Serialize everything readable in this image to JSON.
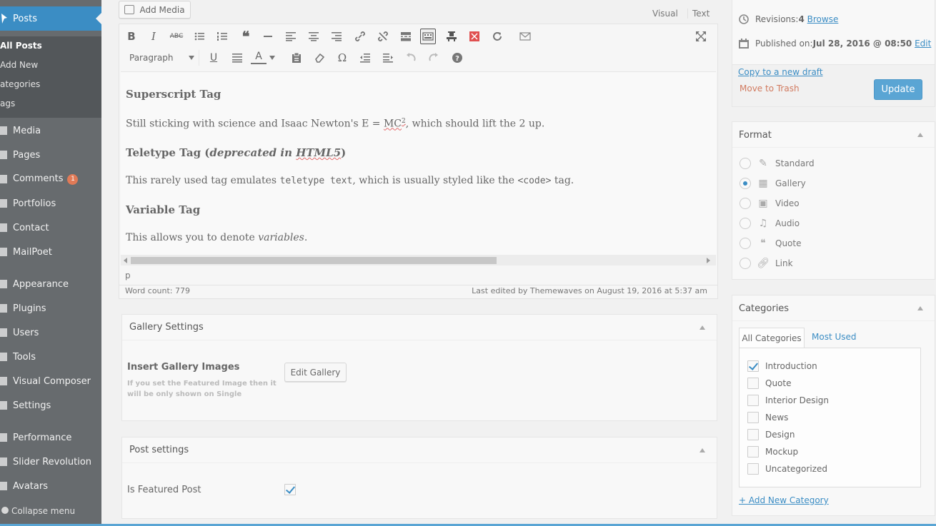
{
  "admin_menu": {
    "posts_label": "Posts",
    "submenu": [
      "All Posts",
      "Add New",
      "ategories",
      "ags"
    ],
    "items": [
      "Media",
      "Pages",
      "Comments",
      "Portfolios",
      "Contact",
      "MailPoet",
      "Appearance",
      "Plugins",
      "Users",
      "Tools",
      "Visual Composer",
      "Settings",
      "Performance",
      "Slider Revolution",
      "Avatars"
    ],
    "comments_badge": "1",
    "collapse_label": "Collapse menu"
  },
  "editor": {
    "add_media_label": "Add Media",
    "tab_visual": "Visual",
    "tab_text": "Text",
    "format_select": "Paragraph",
    "content": {
      "h_superscript": "Superscript Tag",
      "p_superscript_a": "Still sticking with science and Isaac Newton's E = ",
      "p_superscript_mc": "MC",
      "p_superscript_sup": "2",
      "p_superscript_b": ", which should lift the 2 up.",
      "h_teletype_a": "Teletype Tag (",
      "h_teletype_em": "deprecated in ",
      "h_teletype_html5": "HTML5",
      "h_teletype_b": ")",
      "p_teletype_a": "This rarely used tag emulates ",
      "p_teletype_code1": "teletype text",
      "p_teletype_b": ", which is usually styled like the ",
      "p_teletype_code2": "<code>",
      "p_teletype_c": " tag.",
      "h_variable": "Variable Tag",
      "p_variable_a": "This allows you to denote ",
      "p_variable_em": "variables",
      "p_variable_b": "."
    },
    "path": "p",
    "word_count": "Word count: 779",
    "last_edited": "Last edited by Themewaves on August 19, 2016 at 5:37 am"
  },
  "gallery_settings": {
    "title": "Gallery Settings",
    "insert_label": "Insert Gallery Images",
    "description": "If you set the Featured Image then it will be only shown on Single",
    "edit_button": "Edit Gallery"
  },
  "post_settings": {
    "title": "Post settings",
    "featured_label": "Is Featured Post",
    "featured_checked": true
  },
  "publish": {
    "revisions_label": "Revisions: ",
    "revisions_count": "4",
    "browse_link": "Browse",
    "published_label": "Published on: ",
    "published_date": "Jul 28, 2016 @ 08:50",
    "edit_link": "Edit",
    "copy_draft": "Copy to a new draft",
    "move_trash": "Move to Trash",
    "update_button": "Update"
  },
  "format_box": {
    "title": "Format",
    "options": [
      "Standard",
      "Gallery",
      "Video",
      "Audio",
      "Quote",
      "Link"
    ],
    "selected": "Gallery"
  },
  "categories": {
    "title": "Categories",
    "tab_all": "All Categories",
    "tab_used": "Most Used",
    "items": [
      "Introduction",
      "Quote",
      "Interior Design",
      "News",
      "Design",
      "Mockup",
      "Uncategorized"
    ],
    "checked": [
      "Introduction"
    ],
    "add_new": "+ Add New Category"
  },
  "colors": {
    "accent": "#3b8dc4",
    "sidebar": "#676b6e",
    "update_button": "#5aa5d4",
    "trash": "#d17a5f"
  }
}
